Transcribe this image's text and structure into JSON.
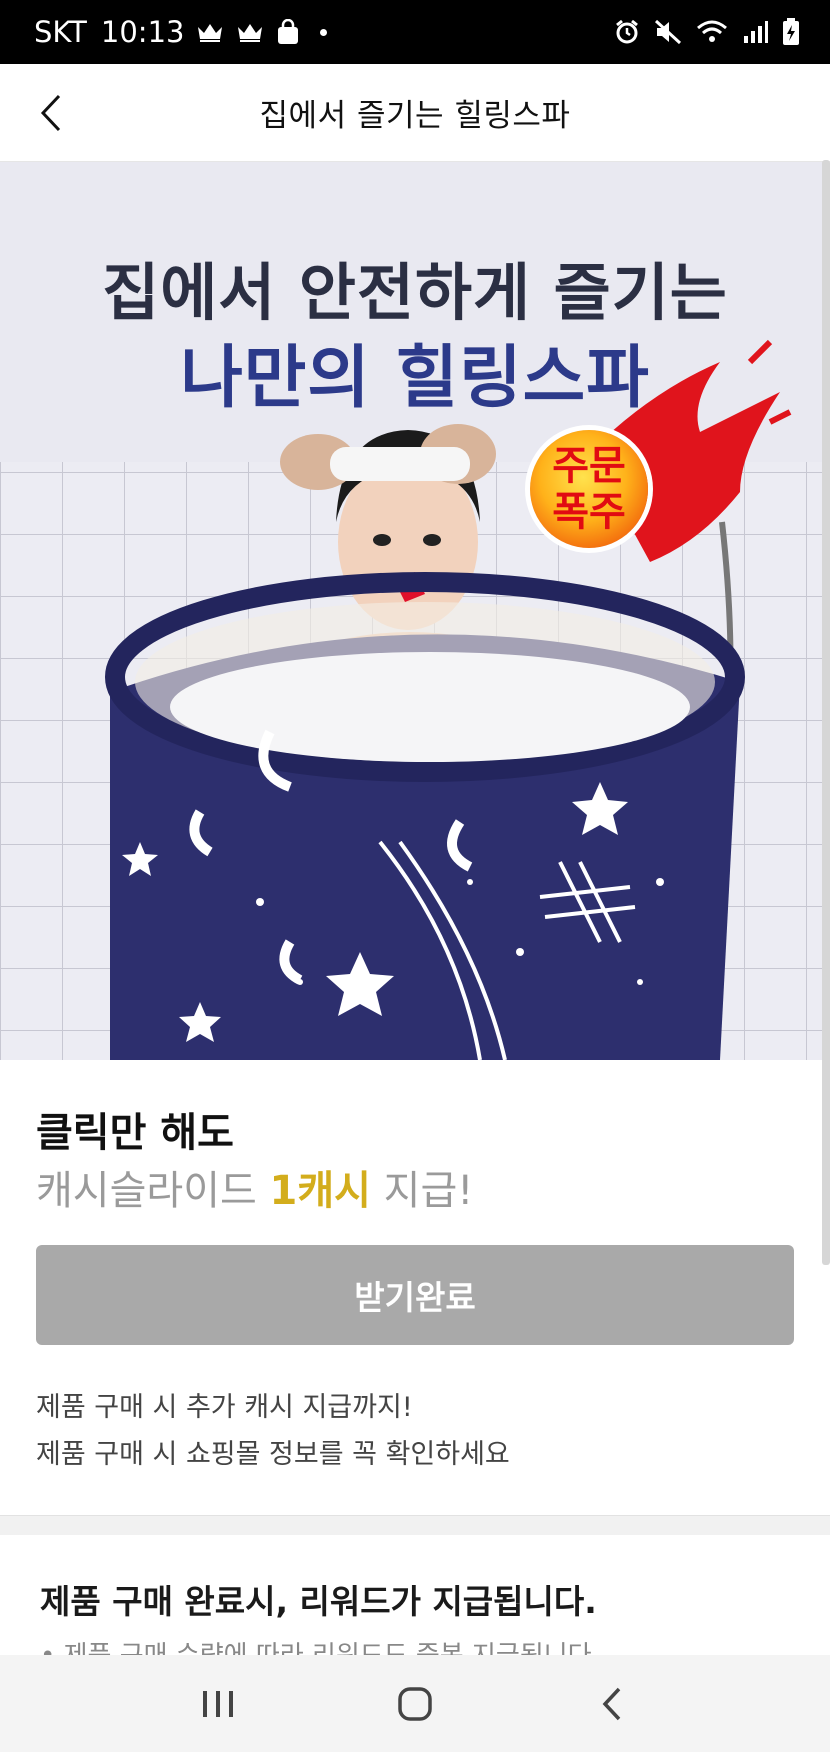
{
  "status_bar": {
    "carrier": "SKT",
    "time": "10:13"
  },
  "header": {
    "title": "집에서 즐기는 힐링스파"
  },
  "hero": {
    "line1": "집에서 안전하게 즐기는",
    "line2": "나만의 힐링스파",
    "badge_line1": "주문",
    "badge_line2": "폭주"
  },
  "promo": {
    "title": "클릭만 해도",
    "sub_prefix": "캐시슬라이드 ",
    "sub_accent": "1캐시",
    "sub_suffix": " 지급!",
    "button_label": "받기완료",
    "note1": "제품 구매 시 추가 캐시 지급까지!",
    "note2": "제품 구매 시 쇼핑몰 정보를 꼭 확인하세요"
  },
  "reward": {
    "title": "제품 구매 완료시, 리워드가 지급됩니다.",
    "bullet": "• 제품 구매 수량에 따라 리워드도 중복 지급됩니다"
  },
  "icons": {
    "back": "chevron-left-icon",
    "nav_recents": "recents-icon",
    "nav_home": "home-icon",
    "nav_back": "back-icon"
  },
  "colors": {
    "accent": "#d3ad1c",
    "button_disabled": "#a9a9a9",
    "tub": "#2d2f6e"
  }
}
